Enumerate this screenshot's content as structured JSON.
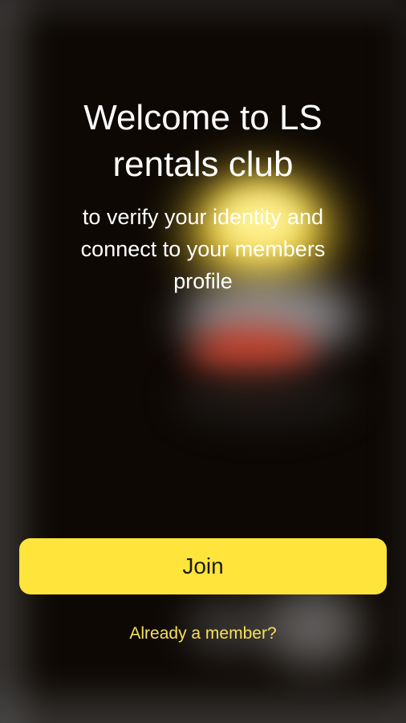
{
  "welcome": {
    "title": "Welcome to LS rentals club",
    "subtitle": "to verify your identity and connect to your members profile"
  },
  "actions": {
    "join_label": "Join",
    "member_link": "Already a member?"
  },
  "colors": {
    "background": "#0d0804",
    "accent": "#ffe53b",
    "link": "#f7e05a",
    "text": "#ffffff"
  }
}
